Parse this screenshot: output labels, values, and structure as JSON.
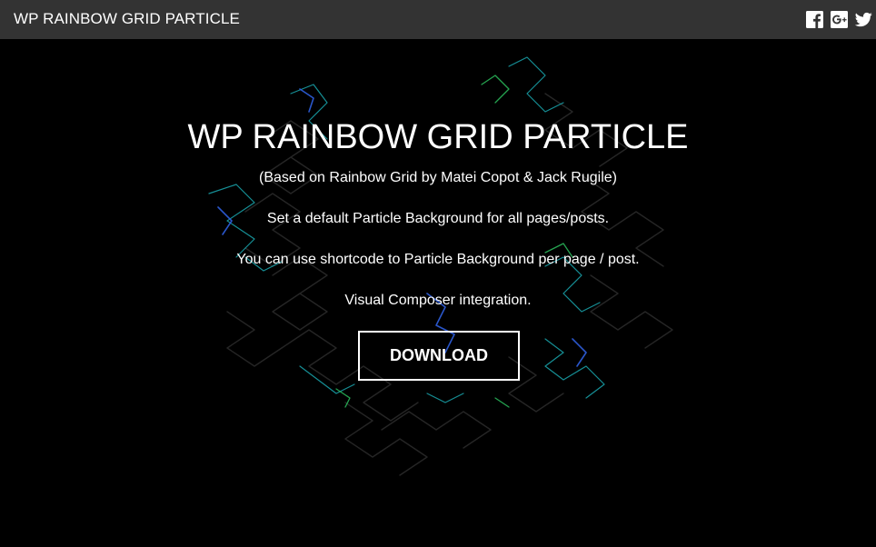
{
  "header": {
    "title": "WP RAINBOW GRID PARTICLE",
    "social": [
      {
        "name": "facebook-icon",
        "glyph": "f"
      },
      {
        "name": "google-plus-icon",
        "glyph": "g+"
      },
      {
        "name": "twitter-icon",
        "glyph": "t"
      }
    ]
  },
  "hero": {
    "title": "WP RAINBOW GRID PARTICLE",
    "subtitle": "(Based on Rainbow Grid by Matei Copot & Jack Rugile)",
    "line1": "Set a default Particle Background for all pages/posts.",
    "line2": "You can use shortcode to Particle Background per page / post.",
    "line3": "Visual Composer integration.",
    "download_label": "DOWNLOAD"
  },
  "colors": {
    "topbar": "#333333",
    "background": "#000000",
    "text": "#ffffff",
    "particle_cyan": "#19c3c8",
    "particle_blue": "#2a5bd7",
    "particle_green": "#2bbf5e"
  }
}
